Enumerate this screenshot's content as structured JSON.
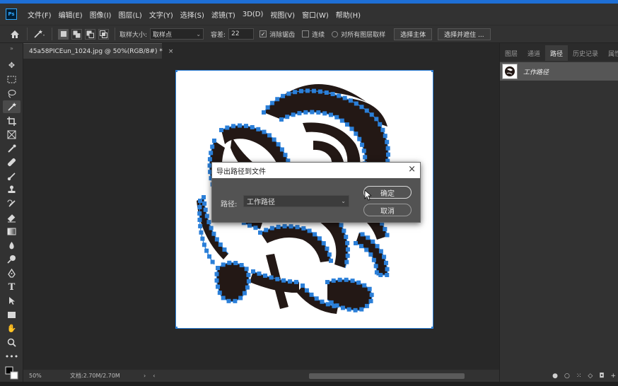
{
  "app": {
    "logo_text": "Ps",
    "accent_color": "#1e6fd6"
  },
  "menu": {
    "items": [
      "文件(F)",
      "编辑(E)",
      "图像(I)",
      "图层(L)",
      "文字(Y)",
      "选择(S)",
      "滤镜(T)",
      "3D(D)",
      "视图(V)",
      "窗口(W)",
      "帮助(H)"
    ]
  },
  "options": {
    "sample_size_label": "取样大小:",
    "sample_size_value": "取样点",
    "tolerance_label": "容差:",
    "tolerance_value": "22",
    "antialias_label": "消除锯齿",
    "antialias_checked": true,
    "contiguous_label": "连续",
    "contiguous_checked": false,
    "sample_all_label": "对所有图层取样",
    "select_subject_label": "选择主体",
    "select_mask_label": "选择并遮住 ..."
  },
  "document": {
    "tab_title": "45a58PICEun_1024.jpg @ 50%(RGB/8#) *",
    "tab_close": "×",
    "zoom": "50%",
    "doc_size": "文档:2.70M/2.70M",
    "status_arrow": "›",
    "scroll_left": "‹"
  },
  "panels": {
    "tabs": [
      "图层",
      "通道",
      "路径",
      "历史记录",
      "属性"
    ],
    "active_tab": "路径",
    "path_name": "工作路径"
  },
  "dialog": {
    "title": "导出路径到文件",
    "close": "×",
    "path_label": "路径:",
    "path_value": "工作路径",
    "ok_label": "确定",
    "cancel_label": "取消"
  }
}
